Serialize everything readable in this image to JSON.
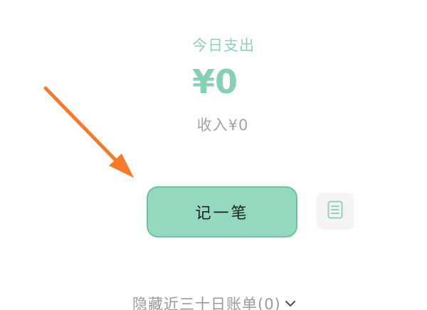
{
  "summary": {
    "today_expense_label": "今日支出",
    "today_expense_amount": "¥0",
    "income_text": "收入¥0"
  },
  "actions": {
    "record_button_label": "记一笔",
    "bill_list_icon": "document-list-icon"
  },
  "footer": {
    "hide_bills_label": "隐藏近三十日账单(0)",
    "toggle_icon": "chevron-down-icon"
  },
  "colors": {
    "accent_green": "#86d0b4",
    "button_fill": "#94d8be",
    "annotation_arrow": "#f57a2c"
  }
}
